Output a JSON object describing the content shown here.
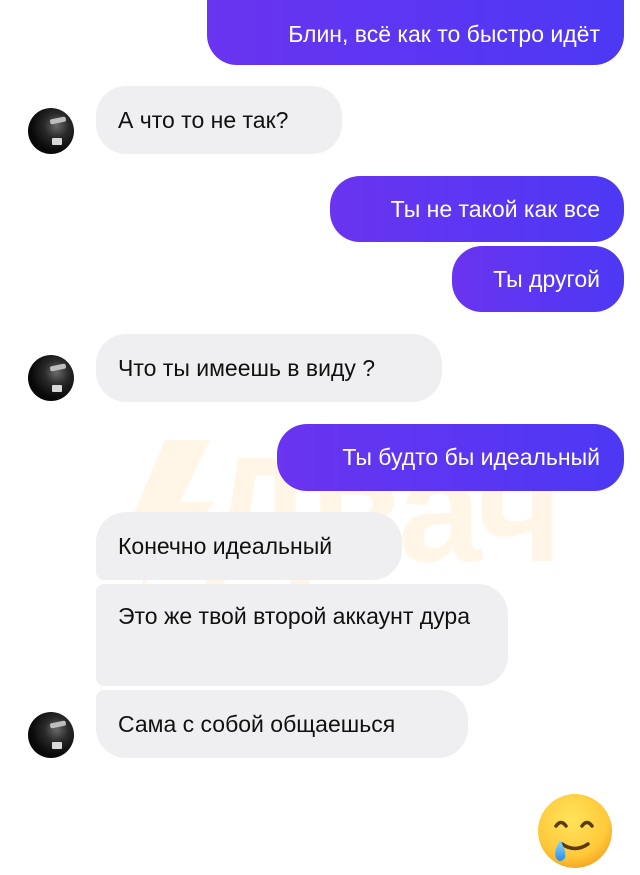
{
  "chat": {
    "messages": [
      {
        "id": "m1",
        "side": "out",
        "text": "Блин, всё как то быстро идёт"
      },
      {
        "id": "m2",
        "side": "in",
        "text": "А что то не так?"
      },
      {
        "id": "m3",
        "side": "out",
        "text": "Ты не такой как все"
      },
      {
        "id": "m4",
        "side": "out",
        "text": "Ты другой"
      },
      {
        "id": "m5",
        "side": "in",
        "text": "Что ты имеешь в виду ?"
      },
      {
        "id": "m6",
        "side": "out",
        "text": "Ты будто бы идеальный"
      },
      {
        "id": "m7",
        "side": "in",
        "text": "Конечно идеальный"
      },
      {
        "id": "m8",
        "side": "in",
        "text": "Это же твой второй аккаунт дура"
      },
      {
        "id": "m9",
        "side": "in",
        "text": "Сама с собой общаешься"
      }
    ]
  },
  "watermark": {
    "text": "Двач",
    "color": "#ffc86e"
  },
  "emoji": {
    "icon": "smiling-face-with-tear-icon"
  },
  "colors": {
    "outgoing_start": "#6a34f0",
    "outgoing_end": "#4d38f4",
    "incoming_bg": "#efeff1",
    "incoming_text": "#111111"
  }
}
